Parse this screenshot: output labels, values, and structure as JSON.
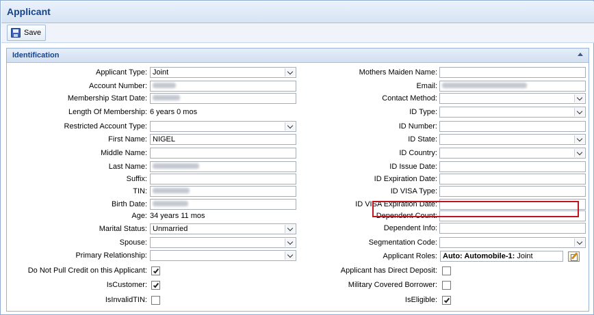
{
  "window": {
    "title": "Applicant"
  },
  "toolbar": {
    "save_label": "Save"
  },
  "panel": {
    "title": "Identification"
  },
  "left": {
    "applicant_type": {
      "label": "Applicant Type:",
      "value": "Joint"
    },
    "account_number": {
      "label": "Account Number:"
    },
    "membership_start_date": {
      "label": "Membership Start Date:"
    },
    "length_of_membership": {
      "label": "Length Of Membership:",
      "value": "6 years 0 mos"
    },
    "restricted_account_type": {
      "label": "Restricted Account Type:",
      "value": ""
    },
    "first_name": {
      "label": "First Name:",
      "value": "NIGEL"
    },
    "middle_name": {
      "label": "Middle Name:",
      "value": ""
    },
    "last_name": {
      "label": "Last Name:"
    },
    "suffix": {
      "label": "Suffix:",
      "value": ""
    },
    "tin": {
      "label": "TIN:"
    },
    "birth_date": {
      "label": "Birth Date:"
    },
    "age": {
      "label": "Age:",
      "value": "34 years 11 mos"
    },
    "marital_status": {
      "label": "Marital Status:",
      "value": "Unmarried"
    },
    "spouse": {
      "label": "Spouse:",
      "value": ""
    },
    "primary_relationship": {
      "label": "Primary Relationship:",
      "value": ""
    },
    "do_not_pull_credit": {
      "label": "Do Not Pull Credit on this Applicant:",
      "checked": true
    },
    "is_customer": {
      "label": "IsCustomer:",
      "checked": true
    },
    "is_invalid_tin": {
      "label": "IsInvalidTIN:",
      "checked": false
    }
  },
  "right": {
    "mothers_maiden_name": {
      "label": "Mothers Maiden Name:",
      "value": ""
    },
    "email": {
      "label": "Email:"
    },
    "contact_method": {
      "label": "Contact Method:",
      "value": ""
    },
    "id_type": {
      "label": "ID Type:",
      "value": ""
    },
    "id_number": {
      "label": "ID Number:",
      "value": ""
    },
    "id_state": {
      "label": "ID State:",
      "value": ""
    },
    "id_country": {
      "label": "ID Country:",
      "value": ""
    },
    "id_issue_date": {
      "label": "ID Issue Date:",
      "value": ""
    },
    "id_expiration_date": {
      "label": "ID Expiration Date:",
      "value": ""
    },
    "id_visa_type": {
      "label": "ID VISA Type:",
      "value": ""
    },
    "id_visa_expiration_date": {
      "label": "ID VISA Expiration Date:",
      "value": ""
    },
    "dependent_count": {
      "label": "Dependent Count:",
      "value": ""
    },
    "dependent_info": {
      "label": "Dependent Info:",
      "value": ""
    },
    "segmentation_code": {
      "label": "Segmentation Code:",
      "value": ""
    },
    "applicant_roles": {
      "label": "Applicant Roles:",
      "role_bold": "Auto: Automobile-1:",
      "role_value": "Joint"
    },
    "has_direct_deposit": {
      "label": "Applicant has Direct Deposit:",
      "checked": false
    },
    "military_covered_borrower": {
      "label": "Military Covered Borrower:",
      "checked": false
    },
    "is_eligible": {
      "label": "IsEligible:",
      "checked": true
    }
  },
  "icons": {
    "save": "floppy-disk-icon",
    "collapse": "collapse-arrow-icon",
    "edit": "edit-icon",
    "dropdown": "chevron-down-icon",
    "check": "checkmark-icon"
  },
  "colors": {
    "title": "#15428b",
    "highlight_border": "#c0121f",
    "header_bg": "#d7e4f4"
  }
}
